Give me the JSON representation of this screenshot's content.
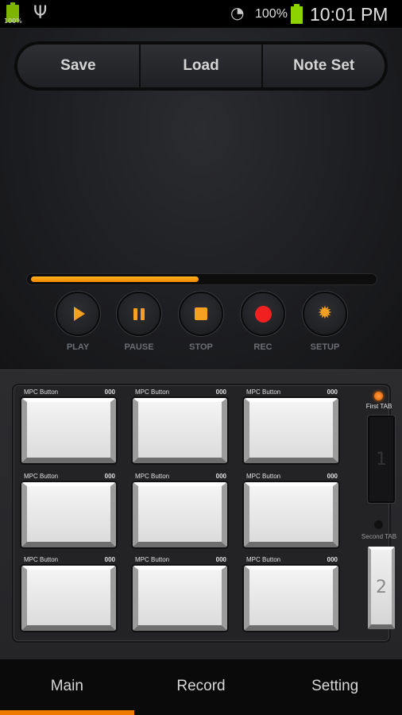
{
  "status_bar": {
    "left_battery_pct": "100%",
    "usb_icon": "usb-icon",
    "wifi_icon": "wifi-icon",
    "battery_pct": "100%",
    "time": "10:01 PM"
  },
  "top_buttons": [
    {
      "label": "Save"
    },
    {
      "label": "Load"
    },
    {
      "label": "Note Set"
    }
  ],
  "progress": {
    "value_percent": 49,
    "color": "#f5a020"
  },
  "controls": [
    {
      "label": "PLAY",
      "icon": "play-icon"
    },
    {
      "label": "PAUSE",
      "icon": "pause-icon"
    },
    {
      "label": "STOP",
      "icon": "stop-icon"
    },
    {
      "label": "REC",
      "icon": "record-icon"
    },
    {
      "label": "SETUP",
      "icon": "setup-icon",
      "glyph": "✹"
    }
  ],
  "pads": [
    {
      "label": "MPC Button",
      "value": "000"
    },
    {
      "label": "MPC Button",
      "value": "000"
    },
    {
      "label": "MPC Button",
      "value": "000"
    },
    {
      "label": "MPC Button",
      "value": "000"
    },
    {
      "label": "MPC Button",
      "value": "000"
    },
    {
      "label": "MPC Button",
      "value": "000"
    },
    {
      "label": "MPC Button",
      "value": "000"
    },
    {
      "label": "MPC Button",
      "value": "000"
    },
    {
      "label": "MPC Button",
      "value": "000"
    }
  ],
  "tabs": [
    {
      "label": "First TAB",
      "number": "1",
      "active": true
    },
    {
      "label": "Second TAB",
      "number": "2",
      "active": false
    }
  ],
  "bottom_nav": [
    {
      "label": "Main",
      "active": true
    },
    {
      "label": "Record",
      "active": false
    },
    {
      "label": "Setting",
      "active": false
    }
  ],
  "colors": {
    "accent": "#f07a00",
    "record": "#f02020"
  }
}
